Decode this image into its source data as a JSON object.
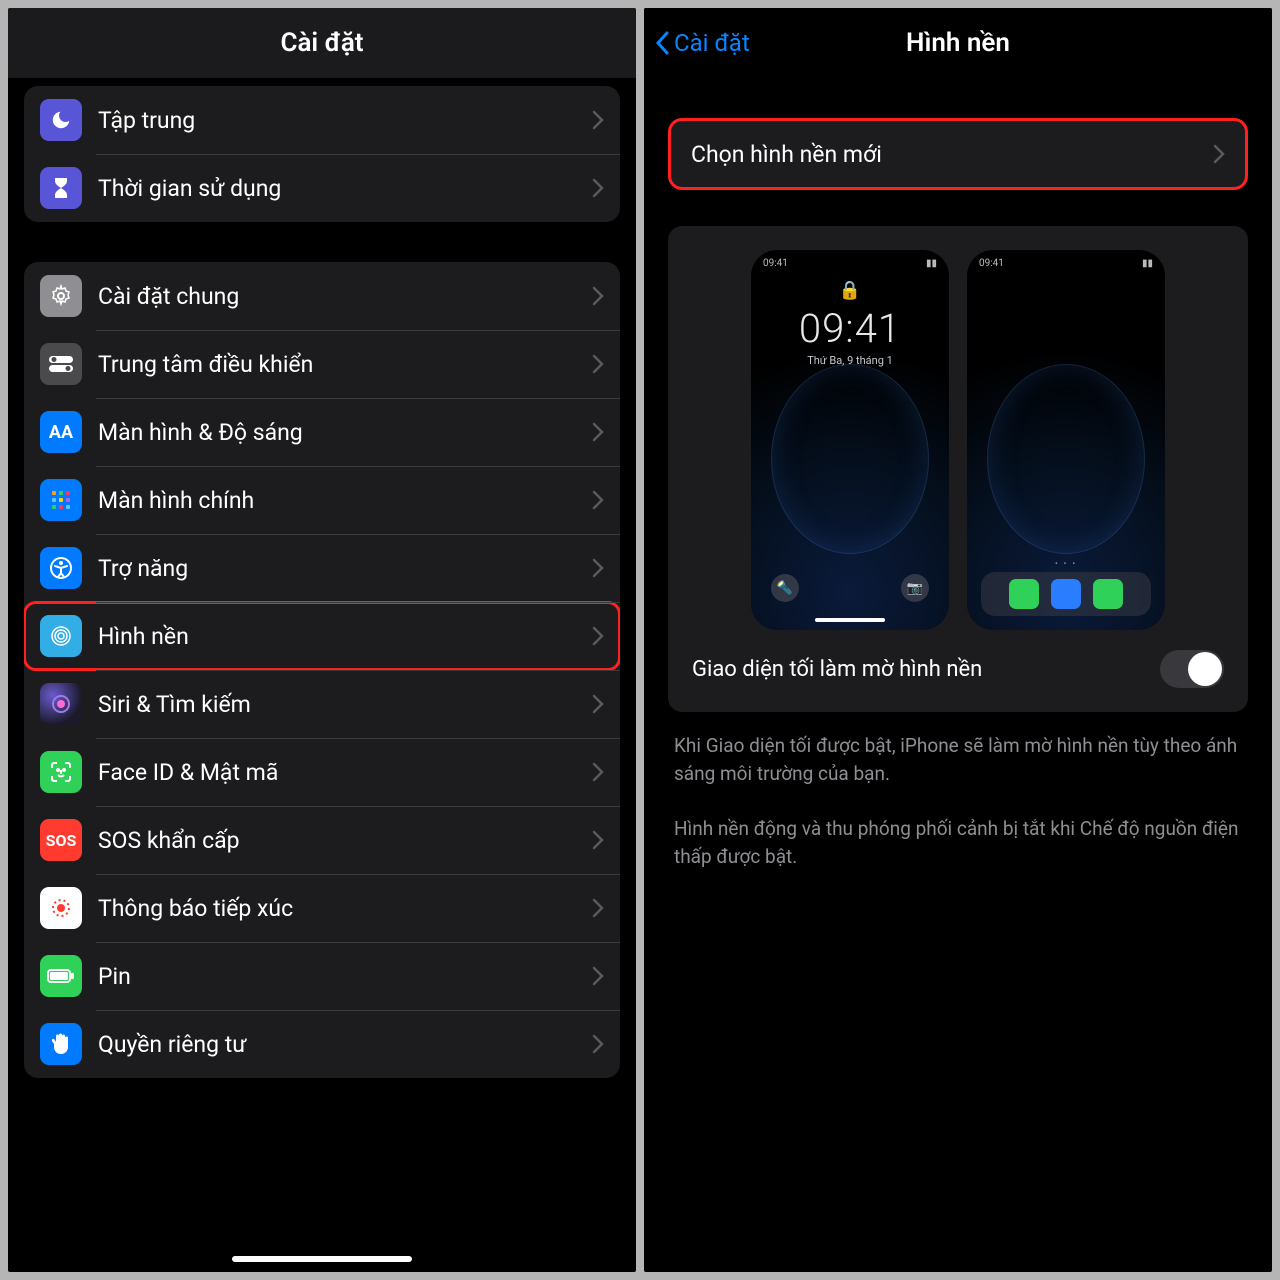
{
  "left": {
    "title": "Cài đặt",
    "group1": [
      {
        "id": "focus",
        "label": "Tập trung"
      },
      {
        "id": "screentime",
        "label": "Thời gian sử dụng"
      }
    ],
    "group2": [
      {
        "id": "general",
        "label": "Cài đặt chung"
      },
      {
        "id": "controlcenter",
        "label": "Trung tâm điều khiển"
      },
      {
        "id": "display",
        "label": "Màn hình & Độ sáng"
      },
      {
        "id": "homescreen",
        "label": "Màn hình chính"
      },
      {
        "id": "accessibility",
        "label": "Trợ năng"
      },
      {
        "id": "wallpaper",
        "label": "Hình nền"
      },
      {
        "id": "siri",
        "label": "Siri & Tìm kiếm"
      },
      {
        "id": "faceid",
        "label": "Face ID & Mật mã"
      },
      {
        "id": "sos",
        "label": "SOS khẩn cấp"
      },
      {
        "id": "exposure",
        "label": "Thông báo tiếp xúc"
      },
      {
        "id": "battery",
        "label": "Pin"
      },
      {
        "id": "privacy",
        "label": "Quyền riêng tư"
      }
    ]
  },
  "right": {
    "back": "Cài đặt",
    "title": "Hình nền",
    "choose": "Chọn hình nền mới",
    "lock_time": "09:41",
    "lock_date": "Thứ Ba, 9 tháng 1",
    "status_time": "09:41",
    "dim_label": "Giao diện tối làm mờ hình nền",
    "desc1": "Khi Giao diện tối được bật, iPhone sẽ làm mờ hình nền tùy theo ánh sáng môi trường của bạn.",
    "desc2": "Hình nền động và thu phóng phối cảnh bị tắt khi Chế độ nguồn điện thấp được bật."
  }
}
